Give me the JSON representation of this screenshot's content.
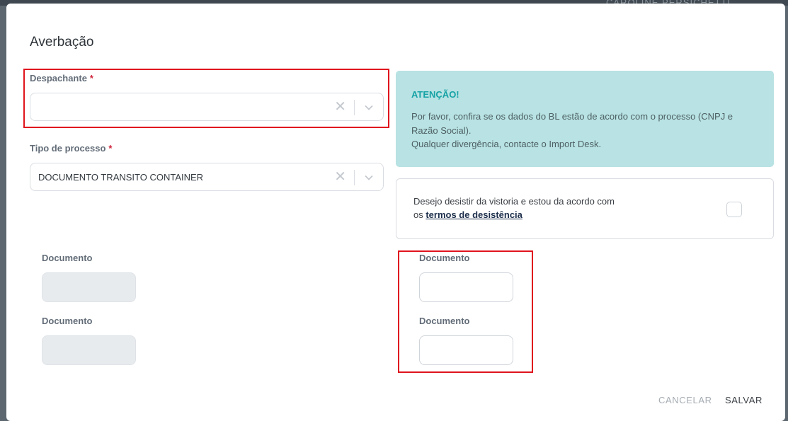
{
  "backdrop": {
    "header_text": "CAROLINE PERSICHETTI ..."
  },
  "modal": {
    "title": "Averbação",
    "despachante": {
      "label": "Despachante",
      "required_mark": "*",
      "value": ""
    },
    "tipo_processo": {
      "label": "Tipo de processo",
      "required_mark": "*",
      "value": "DOCUMENTO TRANSITO CONTAINER"
    },
    "alert": {
      "heading": "ATENÇÃO!",
      "line1": "Por favor, confira se os dados do BL estão de acordo com o processo (CNPJ e",
      "line2": "Razão Social).",
      "line3": "Qualquer divergência, contacte o Import Desk."
    },
    "consent": {
      "line1": "Desejo desistir da vistoria e estou da acordo com",
      "line2_prefix": "os ",
      "link": "termos de desistência",
      "checked": false
    },
    "documents_left": [
      {
        "label": "Documento",
        "value": ""
      },
      {
        "label": "Documento",
        "value": ""
      }
    ],
    "documents_right": [
      {
        "label": "Documento",
        "value": ""
      },
      {
        "label": "Documento",
        "value": ""
      }
    ],
    "buttons": {
      "cancel": "CANCELAR",
      "save": "SALVAR"
    },
    "colors": {
      "highlight_box": "#e0141e",
      "alert_bg": "#b8e2e3",
      "alert_heading": "#16a3a6",
      "required": "#d0253c",
      "link": "#1c2e4a"
    }
  }
}
